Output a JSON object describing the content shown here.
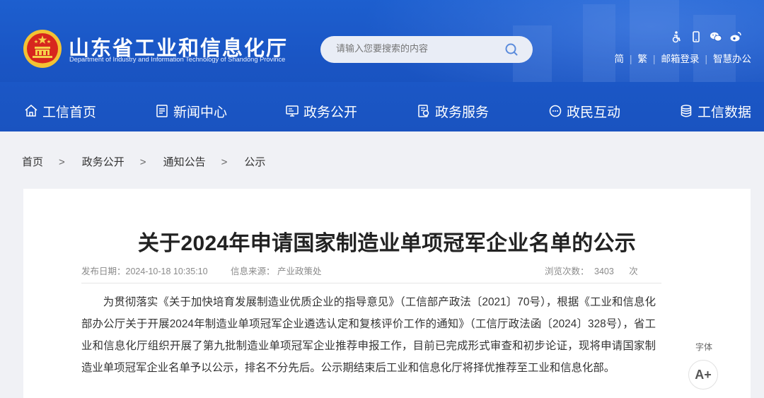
{
  "header": {
    "site_name_cn": "山东省工业和信息化厅",
    "site_name_en": "Department of Industry and Information Technology of Shandong Province",
    "search_placeholder": "请输入您要搜索的内容",
    "top_icons": [
      "accessibility-icon",
      "mobile-icon",
      "wechat-icon",
      "weibo-icon"
    ],
    "top_links": [
      "简",
      "繁",
      "邮箱登录",
      "智慧办公"
    ],
    "accent_color": "#1a55c4"
  },
  "nav": [
    {
      "label": "工信首页",
      "icon": "home-icon"
    },
    {
      "label": "新闻中心",
      "icon": "news-icon"
    },
    {
      "label": "政务公开",
      "icon": "screen-icon"
    },
    {
      "label": "政务服务",
      "icon": "service-icon"
    },
    {
      "label": "政民互动",
      "icon": "chat-icon"
    },
    {
      "label": "工信数据",
      "icon": "database-icon"
    }
  ],
  "breadcrumb": {
    "items": [
      "首页",
      "政务公开",
      "通知公告",
      "公示"
    ],
    "separator": ">"
  },
  "article": {
    "title": "关于2024年申请国家制造业单项冠军企业名单的公示",
    "publish_date": "发布日期：2024-10-18 10:35:10",
    "source": "信息来源： 产业政策处",
    "views_label": "浏览次数：",
    "views_count": "3403",
    "views_unit": "次",
    "body": "为贯彻落实《关于加快培育发展制造业优质企业的指导意见》（工信部产政法〔2021〕70号），根据《工业和信息化部办公厅关于开展2024年制造业单项冠军企业遴选认定和复核评价工作的通知》（工信厅政法函〔2024〕328号），省工业和信息化厅组织开展了第九批制造业单项冠军企业推荐申报工作，目前已完成形式审查和初步论证，现将申请国家制造业单项冠军企业名单予以公示，排名不分先后。公示期结束后工业和信息化厅将择优推荐至工业和信息化部。"
  },
  "font_tool": {
    "label": "字体",
    "increase_label": "A+"
  }
}
